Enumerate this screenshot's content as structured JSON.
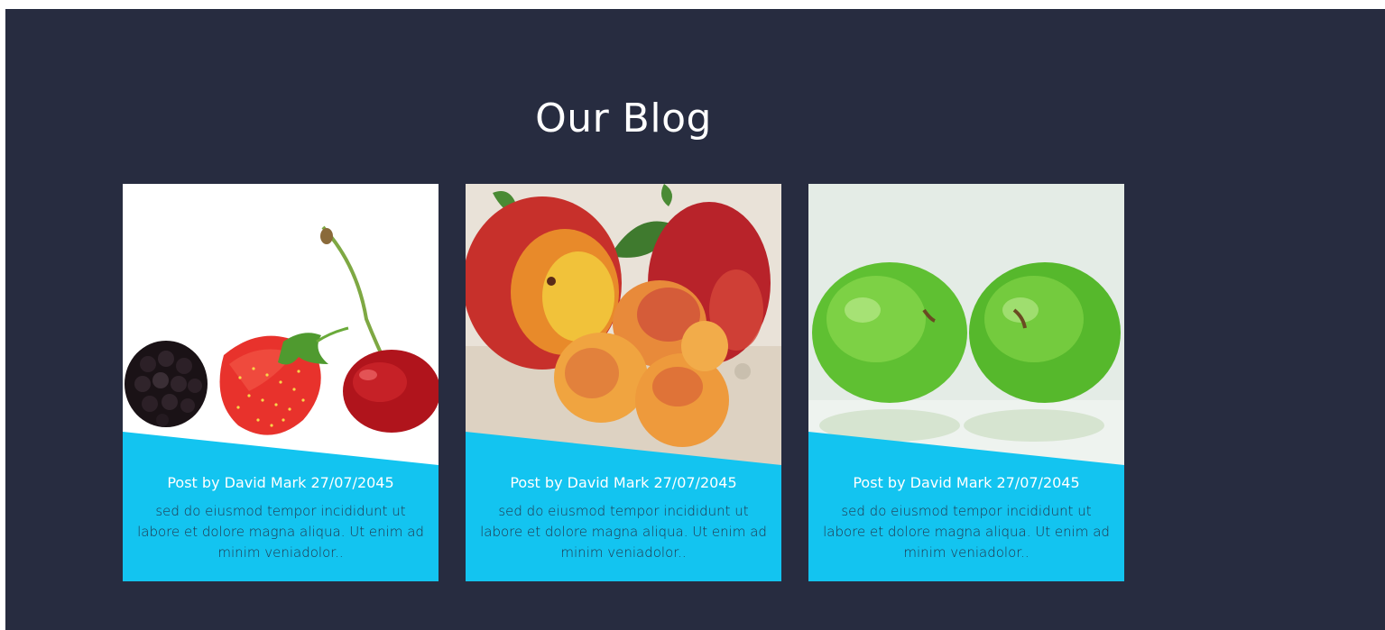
{
  "blog": {
    "title": "Our Blog",
    "accent_color": "#13c4f0",
    "background_color": "#272c40",
    "posts": [
      {
        "image": "berries-and-cherry-photo",
        "meta": "Post by David Mark 27/07/2045",
        "excerpt": "sed do eiusmod tempor incididunt ut labore et dolore magna aliqua. Ut enim ad minim veniadolor.."
      },
      {
        "image": "peaches-photo",
        "meta": "Post by David Mark 27/07/2045",
        "excerpt": "sed do eiusmod tempor incididunt ut labore et dolore magna aliqua. Ut enim ad minim veniadolor.."
      },
      {
        "image": "green-apples-photo",
        "meta": "Post by David Mark 27/07/2045",
        "excerpt": "sed do eiusmod tempor incididunt ut labore et dolore magna aliqua. Ut enim ad minim veniadolor.."
      }
    ]
  }
}
